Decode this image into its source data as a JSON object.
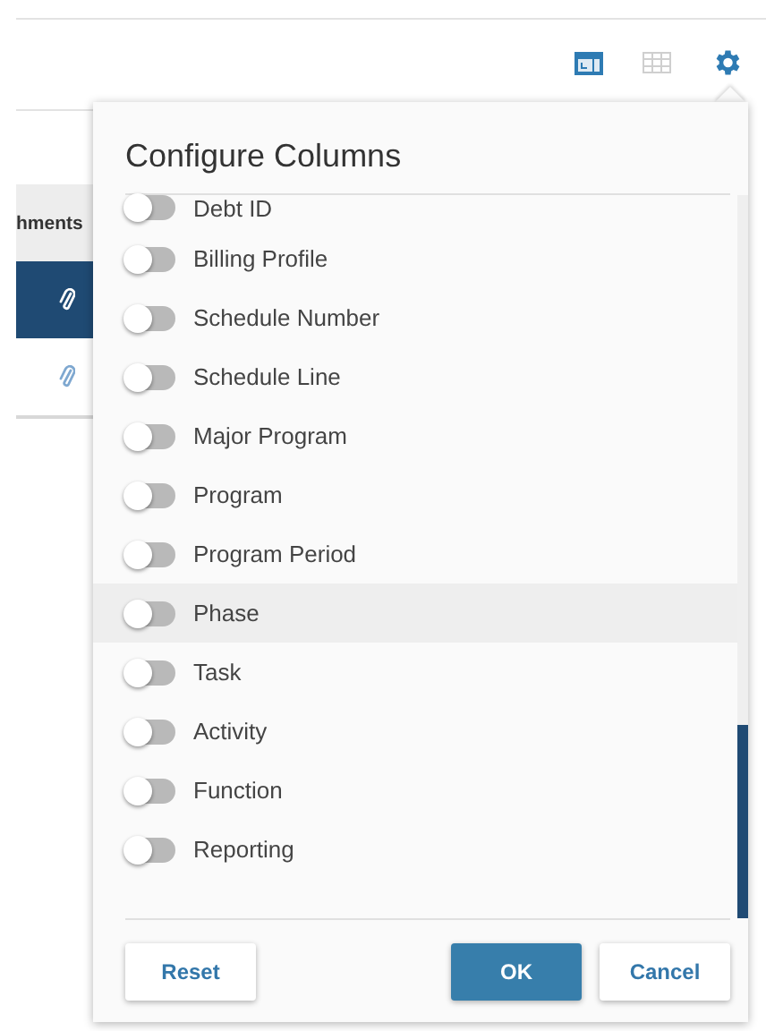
{
  "table": {
    "columns": [
      {
        "label": "hments"
      }
    ],
    "rows": [
      {
        "selected": true,
        "attachment": true
      },
      {
        "selected": false,
        "attachment": true
      }
    ]
  },
  "popup": {
    "title": "Configure Columns",
    "columns": [
      {
        "label": "Debt ID",
        "on": false,
        "highlighted": false
      },
      {
        "label": "Billing Profile",
        "on": false,
        "highlighted": false
      },
      {
        "label": "Schedule Number",
        "on": false,
        "highlighted": false
      },
      {
        "label": "Schedule Line",
        "on": false,
        "highlighted": false
      },
      {
        "label": "Major Program",
        "on": false,
        "highlighted": false
      },
      {
        "label": "Program",
        "on": false,
        "highlighted": false
      },
      {
        "label": "Program Period",
        "on": false,
        "highlighted": false
      },
      {
        "label": "Phase",
        "on": false,
        "highlighted": true
      },
      {
        "label": "Task",
        "on": false,
        "highlighted": false
      },
      {
        "label": "Activity",
        "on": false,
        "highlighted": false
      },
      {
        "label": "Function",
        "on": false,
        "highlighted": false
      },
      {
        "label": "Reporting",
        "on": false,
        "highlighted": false
      }
    ],
    "buttons": [
      {
        "label": "Reset",
        "kind": "secondary"
      },
      {
        "label": "OK",
        "kind": "primary"
      },
      {
        "label": "Cancel",
        "kind": "secondary"
      }
    ]
  }
}
